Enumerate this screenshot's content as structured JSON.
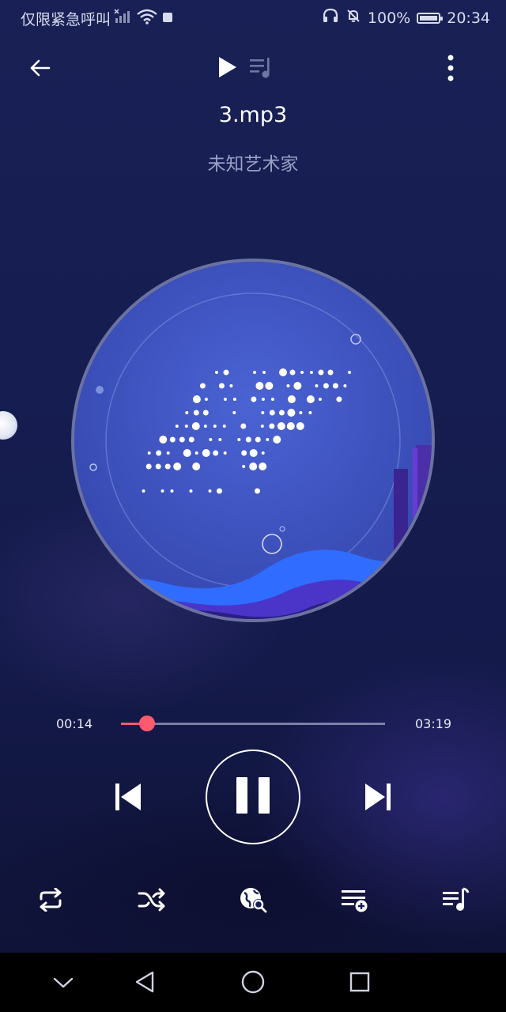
{
  "status_bar": {
    "carrier": "仅限紧急呼叫",
    "battery": "100%",
    "time": "20:34"
  },
  "track": {
    "title": "3.mp3",
    "artist": "未知艺术家"
  },
  "progress": {
    "elapsed": "00:14",
    "total": "03:19",
    "fraction": 0.0975
  },
  "icons": {
    "back": "back-arrow-icon",
    "play_tab": "play-icon",
    "lyrics_tab": "playlist-music-icon",
    "more": "more-vertical-icon",
    "previous": "skip-previous-icon",
    "pause": "pause-icon",
    "next": "skip-next-icon",
    "repeat": "repeat-icon",
    "shuffle": "shuffle-icon",
    "search_online": "search-globe-icon",
    "add_to_playlist": "playlist-add-icon",
    "queue": "queue-music-icon"
  },
  "colors": {
    "accent": "#ff5a6e",
    "background": "#161d50"
  }
}
